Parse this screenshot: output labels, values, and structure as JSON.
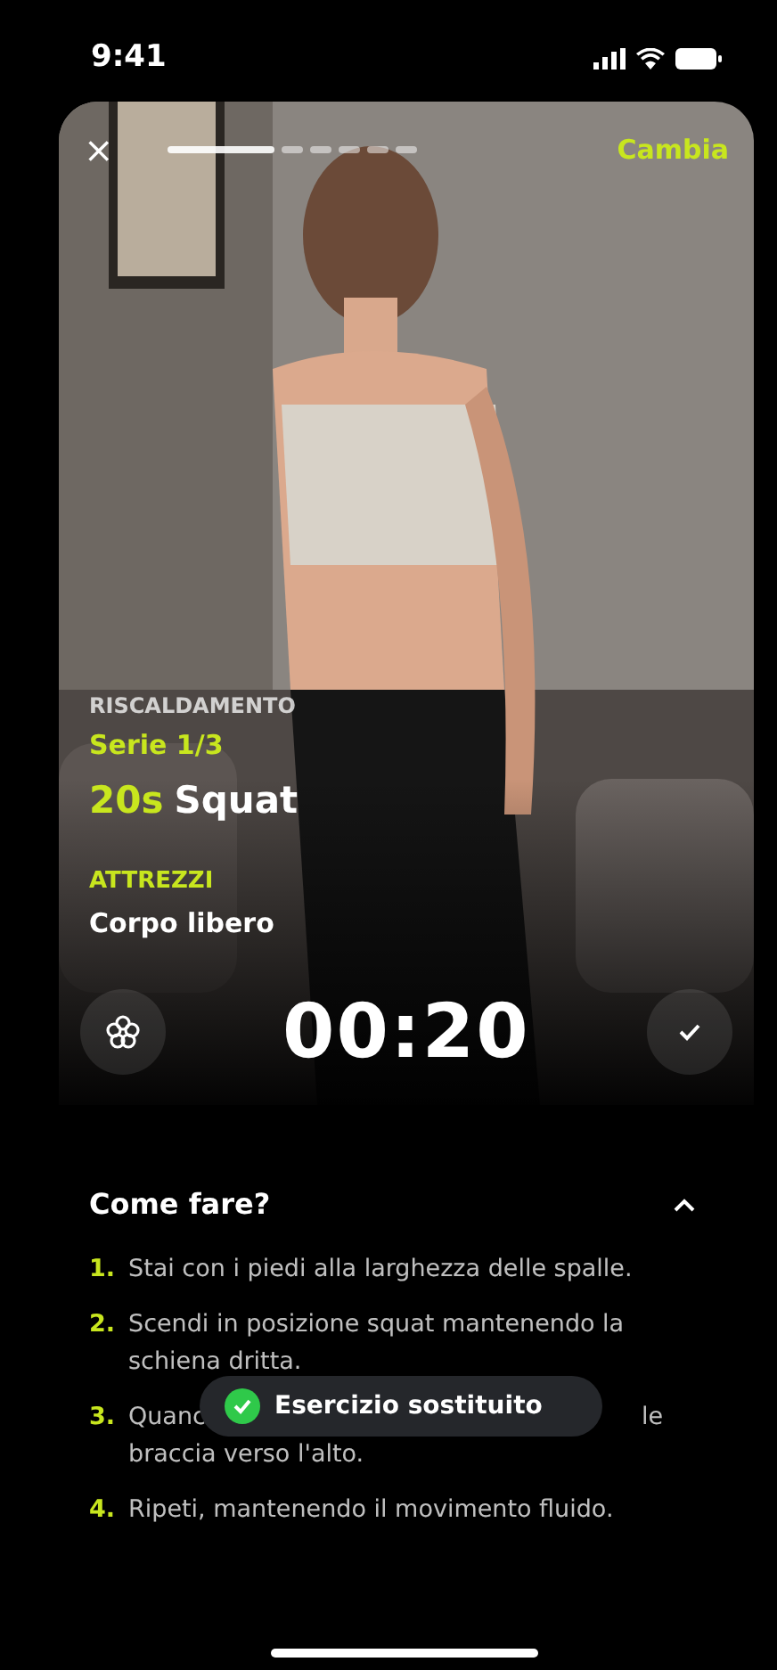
{
  "status_bar": {
    "time": "9:41"
  },
  "player": {
    "close": "×",
    "progress_segments": [
      {
        "selected": true
      },
      {
        "selected": false
      },
      {
        "selected": false
      },
      {
        "selected": false
      },
      {
        "selected": false
      },
      {
        "selected": false
      }
    ],
    "change": "Cambia",
    "phase": "RISCALDAMENTO",
    "set": "Serie 1/3",
    "duration": "20s",
    "exercise": "Squat",
    "equipment_label": "ATTREZZI",
    "equipment": "Corpo libero",
    "timer": "00:20"
  },
  "instructions": {
    "title": "Come fare?",
    "expanded": true,
    "steps": [
      {
        "kind": "text",
        "number": "1.",
        "text": "Stai con i piedi alla larghezza delle spalle."
      },
      {
        "kind": "text",
        "number": "2.",
        "text": "Scendi in posizione squat mantenendo la schiena dritta."
      },
      {
        "kind": "covered",
        "number": "3.",
        "parts": [
          "Quanc",
          "le"
        ],
        "continuation": "braccia verso l'alto."
      },
      {
        "kind": "text",
        "number": "4.",
        "text": "Ripeti, mantenendo il movimento fluido."
      }
    ]
  },
  "toast": {
    "text": "Esercizio sostituito"
  }
}
